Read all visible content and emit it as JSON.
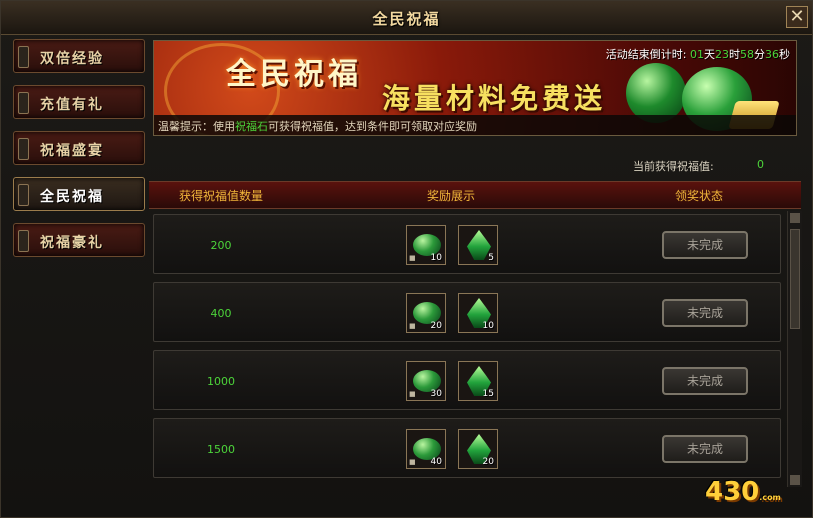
{
  "window": {
    "title": "全民祝福"
  },
  "sidebar": {
    "items": [
      {
        "label": "双倍经验",
        "active": false
      },
      {
        "label": "充值有礼",
        "active": false
      },
      {
        "label": "祝福盛宴",
        "active": false
      },
      {
        "label": "全民祝福",
        "active": true
      },
      {
        "label": "祝福豪礼",
        "active": false
      }
    ]
  },
  "banner": {
    "headline1": "全民祝福",
    "headline2": "海量材料免费送",
    "countdown": {
      "prefix": "活动结束倒计时:",
      "days": "01",
      "days_unit": "天",
      "hours": "23",
      "hours_unit": "时",
      "minutes": "58",
      "minutes_unit": "分",
      "seconds": "36",
      "seconds_unit": "秒"
    },
    "tip": {
      "prefix": "温馨提示：使用",
      "item": "祝福石",
      "suffix": "可获得祝福值，达到条件即可领取对应奖励"
    }
  },
  "current": {
    "label": "当前获得祝福值:",
    "value": "0"
  },
  "table": {
    "headers": {
      "col1": "获得祝福值数量",
      "col2": "奖励展示",
      "col3": "领奖状态"
    },
    "rows": [
      {
        "value": "200",
        "reward1": {
          "icon": "green-stone-icon",
          "count": "10"
        },
        "reward2": {
          "icon": "green-crystal-icon",
          "count": "5"
        },
        "status": "未完成"
      },
      {
        "value": "400",
        "reward1": {
          "icon": "green-stone-icon",
          "count": "20"
        },
        "reward2": {
          "icon": "green-crystal-icon",
          "count": "10"
        },
        "status": "未完成"
      },
      {
        "value": "1000",
        "reward1": {
          "icon": "green-stone-icon",
          "count": "30"
        },
        "reward2": {
          "icon": "green-crystal-icon",
          "count": "15"
        },
        "status": "未完成"
      },
      {
        "value": "1500",
        "reward1": {
          "icon": "green-stone-icon",
          "count": "40"
        },
        "reward2": {
          "icon": "green-crystal-icon",
          "count": "20"
        },
        "status": "未完成"
      }
    ]
  },
  "watermark": {
    "text": "430",
    "suffix": ".com"
  },
  "colors": {
    "accent_green": "#4cd43a",
    "header_gold": "#f0b53a"
  }
}
